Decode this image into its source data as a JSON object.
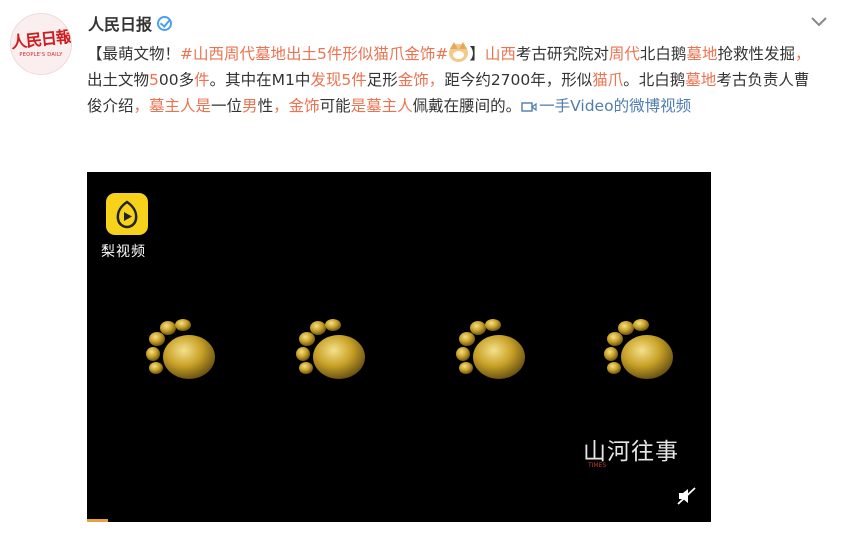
{
  "account": {
    "name": "人民日报",
    "avatar_text": "人民日報",
    "avatar_subtext": "PEOPLE'S DAILY"
  },
  "post": {
    "segments": [
      {
        "text": "【最萌文物！",
        "style": "plain"
      },
      {
        "text": "#山西周代墓地出土5件形似猫爪金饰#",
        "style": "link"
      },
      {
        "emoji": "cat-face-emoji"
      },
      {
        "text": "】",
        "style": "plain"
      },
      {
        "text": "山西",
        "style": "hl"
      },
      {
        "text": "考古研究院对",
        "style": "plain"
      },
      {
        "text": "周代",
        "style": "hl"
      },
      {
        "text": "北白鹅",
        "style": "plain"
      },
      {
        "text": "墓地",
        "style": "hl"
      },
      {
        "text": "抢救性发掘",
        "style": "plain"
      },
      {
        "text": "，",
        "style": "hl"
      },
      {
        "text": "出土文物",
        "style": "plain"
      },
      {
        "text": "5",
        "style": "hl"
      },
      {
        "text": "00多",
        "style": "plain"
      },
      {
        "text": "件",
        "style": "hl"
      },
      {
        "text": "。其中在M1中",
        "style": "plain"
      },
      {
        "text": "发现5件",
        "style": "hl"
      },
      {
        "text": "足形",
        "style": "plain"
      },
      {
        "text": "金饰",
        "style": "hl"
      },
      {
        "text": "，",
        "style": "hl"
      },
      {
        "text": "距今约2700年，形似",
        "style": "plain"
      },
      {
        "text": "猫爪",
        "style": "hl"
      },
      {
        "text": "。北白鹅",
        "style": "plain"
      },
      {
        "text": "墓地",
        "style": "hl"
      },
      {
        "text": "考古负责人曹俊介绍",
        "style": "plain"
      },
      {
        "text": "，墓主人是",
        "style": "hl"
      },
      {
        "text": "一位",
        "style": "plain"
      },
      {
        "text": "男",
        "style": "hl"
      },
      {
        "text": "性",
        "style": "plain"
      },
      {
        "text": "，金饰",
        "style": "hl"
      },
      {
        "text": "可能",
        "style": "plain"
      },
      {
        "text": "是墓主人",
        "style": "hl"
      },
      {
        "text": "佩戴在腰间的。",
        "style": "plain"
      },
      {
        "text": "一手Video的微博视频",
        "style": "video-link"
      }
    ]
  },
  "video": {
    "source_label": "梨视频",
    "watermark": "山河往事",
    "watermark_sub": "TIMES",
    "progress": 0.034
  },
  "colors": {
    "highlight": "#eb7350",
    "link_blue": "#507daf",
    "verified_blue": "#4a9ff0",
    "brand_yellow": "#f7d21b",
    "gold": "#c9a227"
  }
}
